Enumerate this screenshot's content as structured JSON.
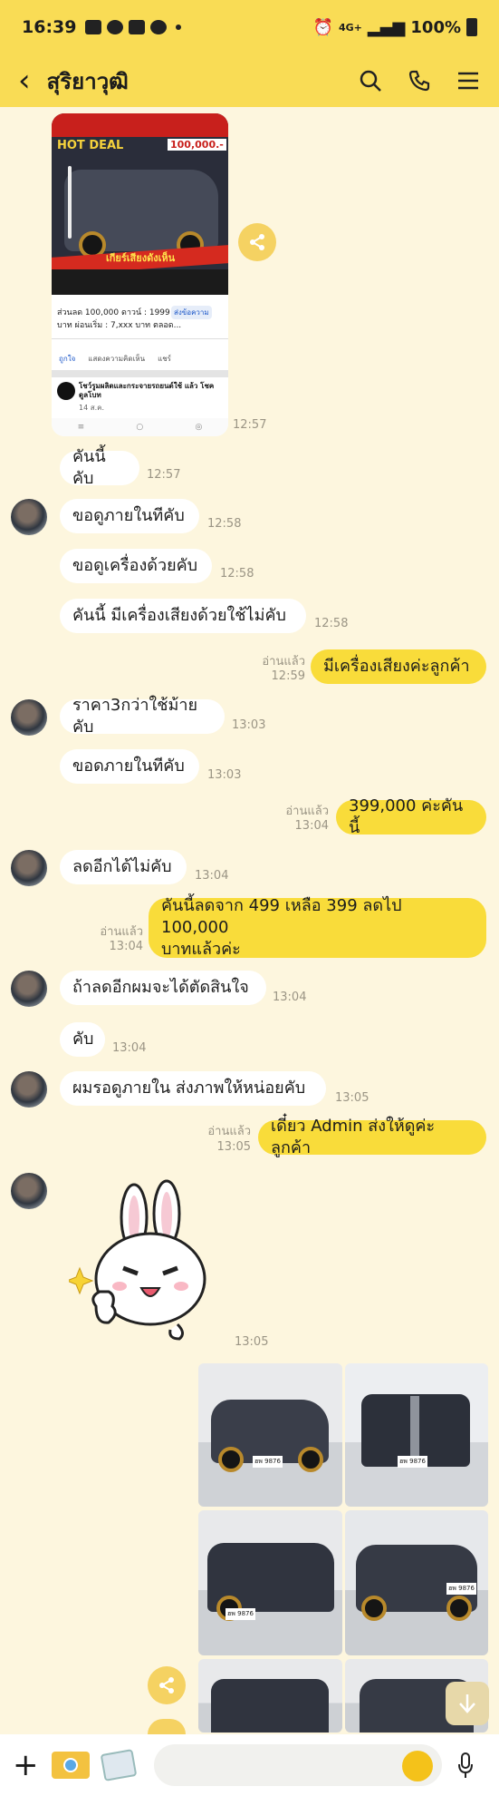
{
  "status_bar": {
    "time": "16:39",
    "network": "4G+",
    "battery": "100%"
  },
  "header": {
    "title": "สุริยาวุฒิ"
  },
  "post": {
    "hot_badge": "HOT DEAL",
    "price_badge": "100,000.-",
    "strip_text": "เกียร์เสียงดังเห็น",
    "caption_line1": "ส่วนลด 100,000 ดาวน์ : 1999",
    "caption_line2": "บาท ผ่อนเริ่ม : 7,xxx บาท ตลอด...",
    "send_label": "ส่งข้อความ",
    "like_label": "ถูกใจ",
    "comment_label": "แสดงความคิดเห็น",
    "share_label": "แชร์",
    "page_name": "โชว์รูมผลิตและกระจายรถยนต์ใช้ แล้ว โชคดูลโบท",
    "page_date": "14 ส.ค."
  },
  "messages": [
    {
      "text": "คันนี้คับ",
      "time": "12:57"
    },
    {
      "text": "ขอดูภายในทีคับ",
      "time": "12:58"
    },
    {
      "text": "ขอดูเครื่องด้วยคับ",
      "time": "12:58"
    },
    {
      "text": "คันนี้ มีเครื่องเสียงด้วยใช้ไม่คับ",
      "time": "12:58"
    },
    {
      "text": "มีเครื่องเสียงค่ะลูกค้า",
      "read": "อ่านแล้ว",
      "time": "12:59"
    },
    {
      "text": "ราคา3กว่าใช้ม้ายคับ",
      "time": "13:03"
    },
    {
      "text": "ขอดภายในทีคับ",
      "time": "13:03"
    },
    {
      "text": "399,000 ค่ะคันนี้",
      "read": "อ่านแล้ว",
      "time": "13:04"
    },
    {
      "text": "ลดอีกได้ไม่คับ",
      "time": "13:04"
    },
    {
      "line1": "คันนี้ลดจาก 499 เหลือ 399 ลดไป 100,000",
      "line2": "บาทแล้วค่ะ",
      "read": "อ่านแล้ว",
      "time": "13:04"
    },
    {
      "text": "ถ้าลดอีกผมจะได้ตัดสินใจ",
      "time": "13:04"
    },
    {
      "text": "คับ",
      "time": "13:04"
    },
    {
      "text": "ผมรอดูภายใน ส่งภาพให้หน่อยคับ",
      "time": "13:05"
    },
    {
      "text": "เดี๋ยว Admin ส่งให้ดูค่ะลูกค้า",
      "read": "อ่านแล้ว",
      "time": "13:05"
    }
  ],
  "first_image_time": "12:57",
  "sticker_time": "13:05",
  "plates": [
    "ฮพ 9876",
    "ฮพ 9876",
    "ฮพ 9876",
    "ฮพ 9876"
  ],
  "colors": {
    "header": "#f9dc55",
    "background": "#fdf6de",
    "my_bubble": "#f9dc3a",
    "their_bubble": "#ffffff"
  }
}
